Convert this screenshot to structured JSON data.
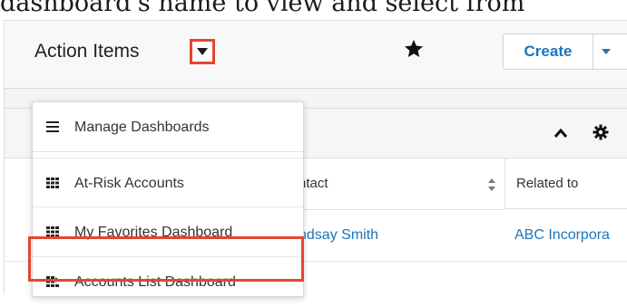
{
  "document": {
    "caption_fragment": "dashboard's name to view and select from"
  },
  "header": {
    "title": "Action Items",
    "create_label": "Create"
  },
  "dashlet": {
    "columns": [
      "Contact",
      "Related to"
    ],
    "columns_visible": [
      "ntact",
      "Related to"
    ],
    "row": {
      "contact": "ndsay Smith",
      "related_to": "ABC Incorpora"
    }
  },
  "dashboard_menu": {
    "items": [
      {
        "label": "Manage Dashboards",
        "icon": "list-icon"
      },
      {
        "label": "At-Risk Accounts",
        "icon": "grid-icon"
      },
      {
        "label": "My Favorites Dashboard",
        "icon": "grid-icon"
      },
      {
        "label": "Accounts List Dashboard",
        "icon": "list-view-grid-icon",
        "highlighted": true
      }
    ]
  },
  "colors": {
    "accent": "#1b75bb",
    "highlight": "#e5452e"
  }
}
